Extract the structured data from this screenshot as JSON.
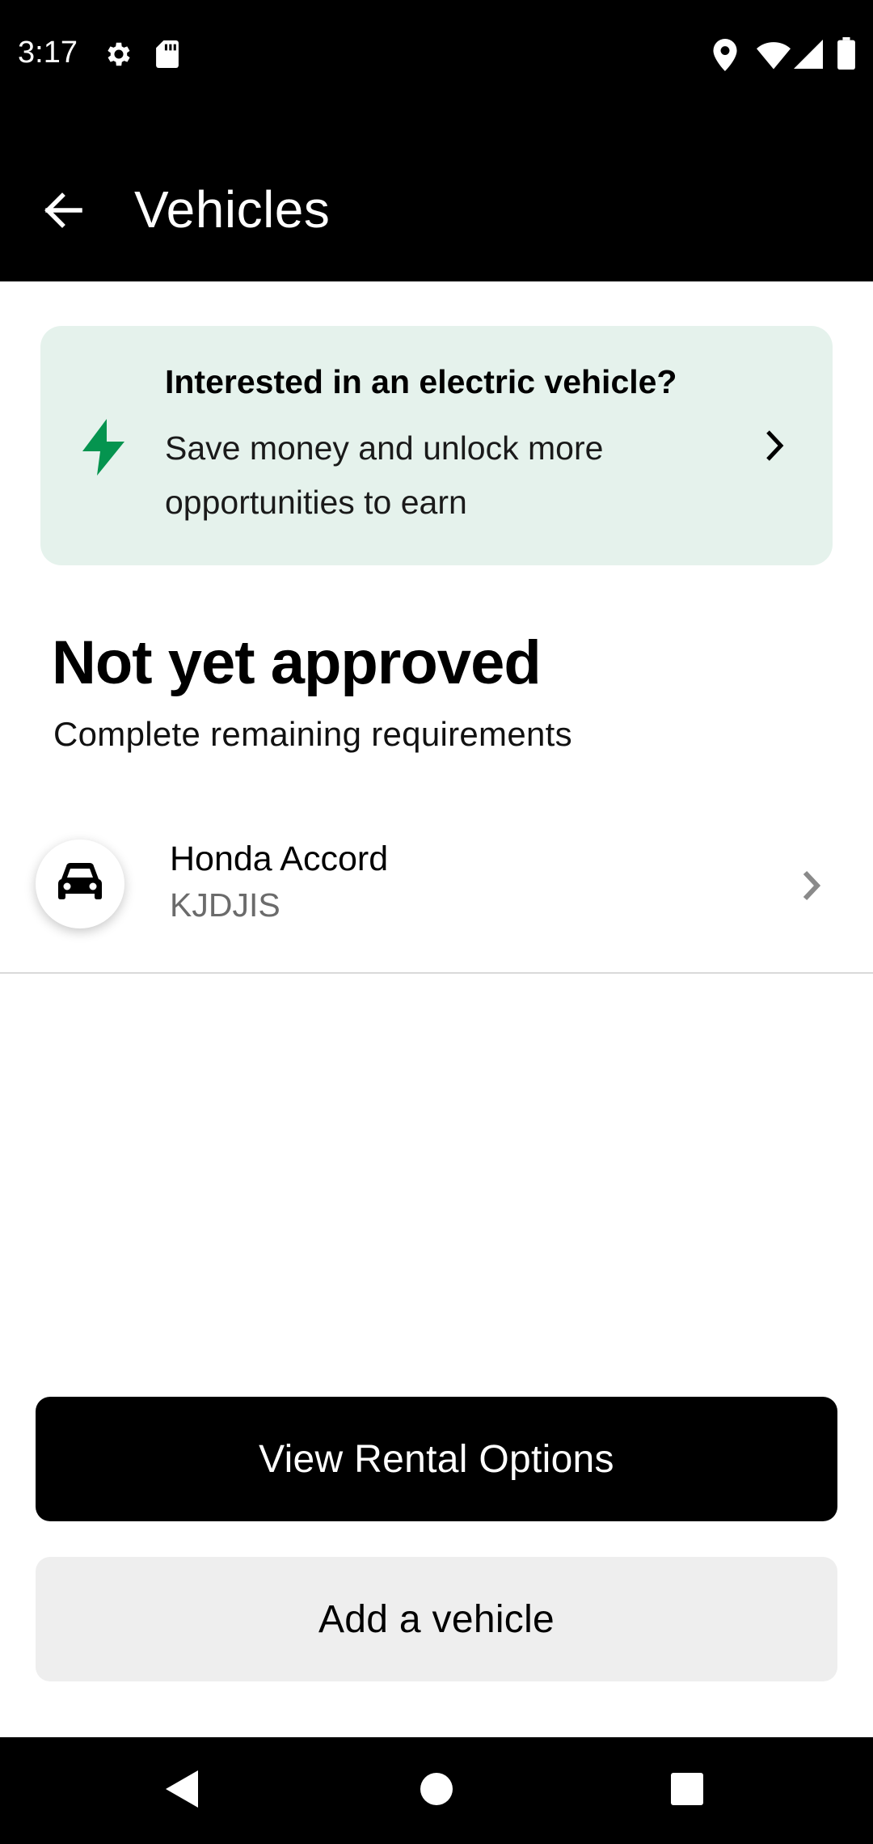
{
  "status_bar": {
    "time": "3:17",
    "icons": [
      "gear-icon",
      "sd-card-icon",
      "location-icon",
      "wifi-icon",
      "signal-icon",
      "battery-icon"
    ]
  },
  "app_bar": {
    "title": "Vehicles",
    "back_icon": "arrow-left-icon"
  },
  "promo": {
    "title": "Interested in an electric vehicle?",
    "body": "Save money and unlock more opportunities to earn",
    "icon": "lightning-bolt-icon",
    "icon_color": "#05944f",
    "background": "#e5f2ec"
  },
  "section": {
    "title": "Not yet approved",
    "subtitle": "Complete remaining requirements"
  },
  "vehicle": {
    "name": "Honda Accord",
    "plate": "KJDJIS",
    "icon": "car-icon"
  },
  "buttons": {
    "primary_label": "View Rental Options",
    "secondary_label": "Add a vehicle"
  },
  "nav_bar": {
    "icons": [
      "nav-back-icon",
      "nav-home-icon",
      "nav-recents-icon"
    ]
  }
}
